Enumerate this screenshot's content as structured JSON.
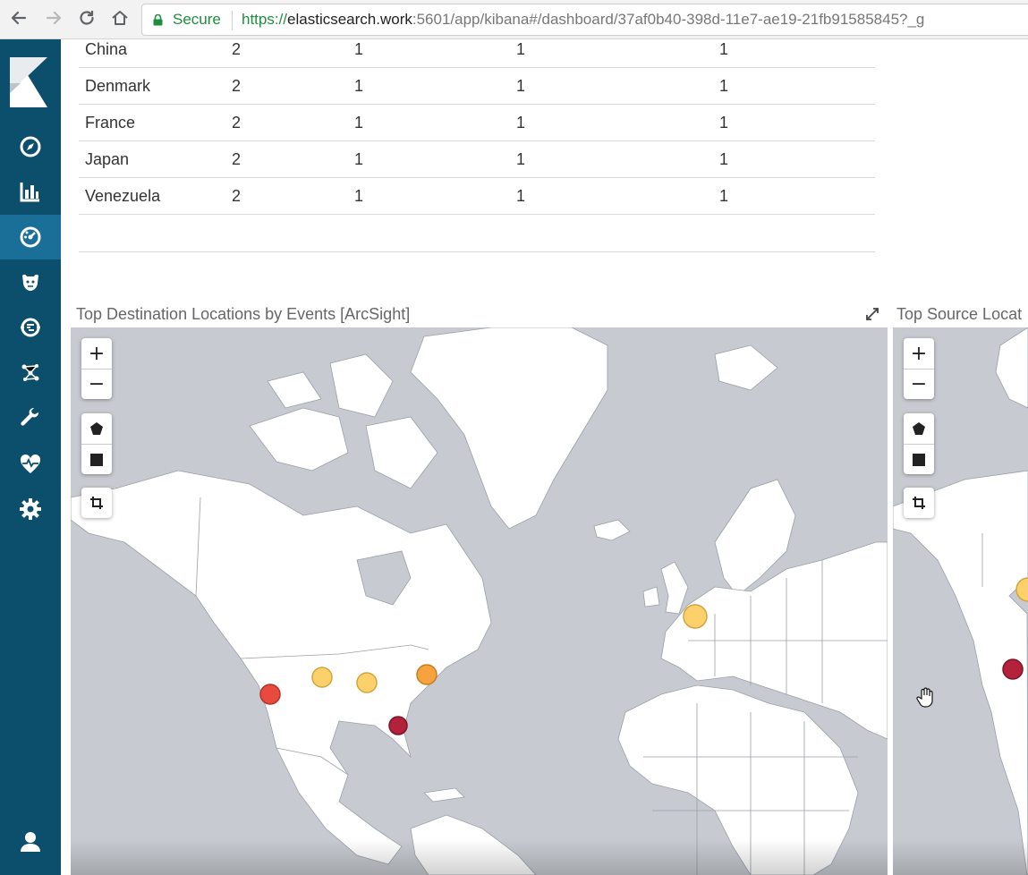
{
  "browser": {
    "secure_label": "Secure",
    "url_protocol": "https://",
    "url_host": "elasticsearch.work",
    "url_path": ":5601/app/kibana#/dashboard/37af0b40-398d-11e7-ae19-21fb91585845?_g"
  },
  "sidebar": {
    "items": [
      {
        "name": "discover",
        "icon": "compass-icon"
      },
      {
        "name": "visualize",
        "icon": "bar-chart-icon"
      },
      {
        "name": "dashboard",
        "icon": "dashboard-gauge-icon",
        "active": true
      },
      {
        "name": "timelion",
        "icon": "timelion-bear-icon"
      },
      {
        "name": "machine-learning",
        "icon": "ml-brain-icon"
      },
      {
        "name": "graph",
        "icon": "graph-network-icon"
      },
      {
        "name": "dev-tools",
        "icon": "wrench-icon"
      },
      {
        "name": "monitoring",
        "icon": "heartbeat-icon"
      },
      {
        "name": "management",
        "icon": "gear-icon"
      },
      {
        "name": "user",
        "icon": "user-icon"
      }
    ]
  },
  "table": {
    "rows": [
      [
        "China",
        "2",
        "1",
        "1",
        "1"
      ],
      [
        "Denmark",
        "2",
        "1",
        "1",
        "1"
      ],
      [
        "France",
        "2",
        "1",
        "1",
        "1"
      ],
      [
        "Japan",
        "2",
        "1",
        "1",
        "1"
      ],
      [
        "Venezuela",
        "2",
        "1",
        "1",
        "1"
      ]
    ]
  },
  "panels": {
    "left_title": "Top Destination Locations by Events [ArcSight]",
    "right_title": "Top Source Locat"
  },
  "map_controls": {
    "zoom_in": "+",
    "zoom_out": "−"
  },
  "colors": {
    "sidebar": "#0b4f6c",
    "sidebar_active": "#1a6f99",
    "map_water": "#c7cbd1",
    "marker_yellow": "#fcd06b",
    "marker_orange": "#f5a23f",
    "marker_red": "#e84a3e",
    "marker_darkred": "#b3213b"
  }
}
